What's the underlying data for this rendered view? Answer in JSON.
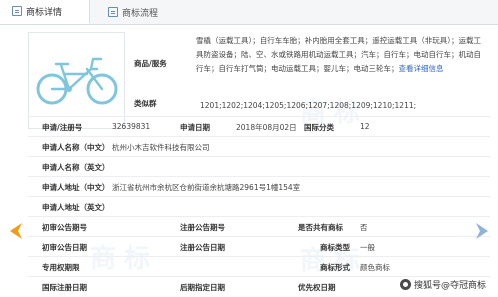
{
  "tabs": [
    {
      "label": "商标详情"
    },
    {
      "label": "商标流程"
    }
  ],
  "goods": {
    "label": "商品/服务",
    "text": "雪橇（运载工具）；自行车车胎；补内胎用全套工具；遥控运载工具（非玩具）；运载工具防盗设备；陆、空、水或铁路用机动运载工具；汽车；自行车；电动自行车；机动自行车；自行车打气筒；电动运载工具；婴儿车；电动三轮车；",
    "link": "查看详细信息"
  },
  "similar_groups": {
    "label": "类似群",
    "value": "1201;1202;1204;1205;1206;1207;1208;1209;1210;1211;"
  },
  "fields": {
    "reg_no_label": "申请/注册号",
    "reg_no": "32639831",
    "apply_date_label": "申请日期",
    "apply_date": "2018年08月02日",
    "intl_class_label": "国际分类",
    "intl_class": "12",
    "applicant_cn_label": "申请人名称（中文）",
    "applicant_cn": "杭州小木吉软件科技有限公司",
    "applicant_en_label": "申请人名称（英文）",
    "applicant_en": "",
    "address_cn_label": "申请人地址（中文）",
    "address_cn": "浙江省杭州市余杭区仓前街道余杭塘路2961号1幢154室",
    "address_en_label": "申请人地址（英文）",
    "address_en": "",
    "prelim_no_label": "初审公告期号",
    "prelim_no": "",
    "reg_pub_no_label": "注册公告期号",
    "reg_pub_no": "",
    "shared_label": "是否共有商标",
    "shared": "否",
    "prelim_date_label": "初审公告日期",
    "prelim_date": "",
    "reg_pub_date_label": "注册公告日期",
    "reg_pub_date": "",
    "tm_type_label": "商标类型",
    "tm_type": "一般",
    "exclusive_label": "专用权期限",
    "exclusive": "",
    "tm_form_label": "商标形式",
    "tm_form": "颜色商标",
    "intl_reg_date_label": "国际注册日期",
    "intl_reg_date": "",
    "later_date_label": "后期指定日期",
    "later_date": "",
    "priority_label": "优先权日期",
    "priority": ""
  },
  "watermark": "商标",
  "credit": "搜狐号@夺冠商标",
  "colors": {
    "bike": "#7fc6dc",
    "arrow": "#f39c12",
    "link": "#3366cc"
  }
}
